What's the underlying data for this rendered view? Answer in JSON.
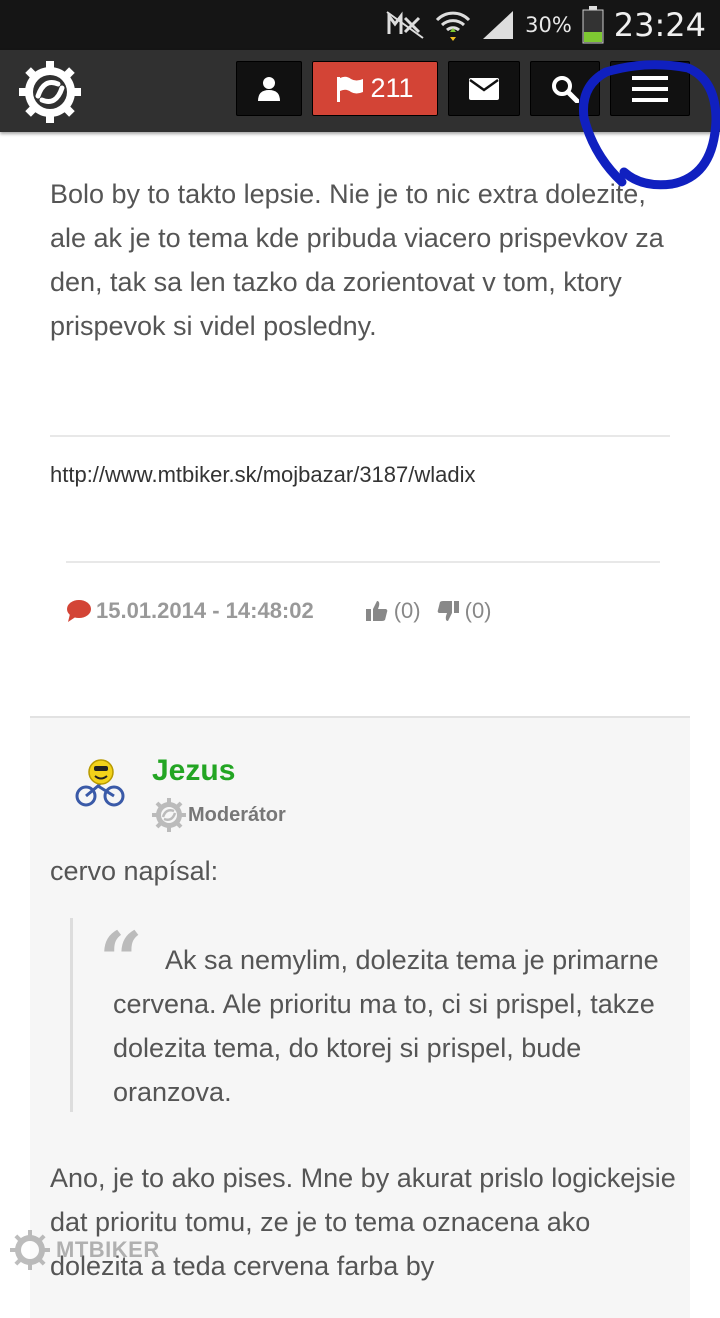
{
  "status_bar": {
    "battery": "30%",
    "time": "23:24"
  },
  "navbar": {
    "notifications_count": "211",
    "icons": [
      "logo-gear-icon",
      "user-icon",
      "flag-icon",
      "envelope-icon",
      "search-icon",
      "hamburger-icon"
    ]
  },
  "post1": {
    "text": "Bolo by to takto lepsie. Nie je to nic extra dolezite, ale ak je to tema kde pribuda viacero prispevkov za den, tak sa len tazko da zorientovat v tom, ktory prispevok si videl posledny.",
    "signature": "http://www.mtbiker.sk/mojbazar/3187/wladix",
    "date": "15.01.2014 - 14:48:02",
    "likes": "(0)",
    "dislikes": "(0)"
  },
  "post2": {
    "author": "Jezus",
    "role": "Moderátor",
    "quote_author": "cervo napísal:",
    "quote": "Ak sa nemylim, dolezita tema je primarne cervena. Ale prioritu ma to, ci si prispel, takze dolezita tema, do ktorej si prispel, bude oranzova.",
    "text": "Ano, je to ako pises. Mne by akurat prislo logickejsie dat prioritu tomu, ze je to tema oznacena ako dolezita a teda cervena farba by"
  },
  "watermark": "MTBIKER",
  "colors": {
    "accent_red": "#d34436",
    "moderator_green": "#23a523",
    "annotation_blue": "#1020c0"
  }
}
